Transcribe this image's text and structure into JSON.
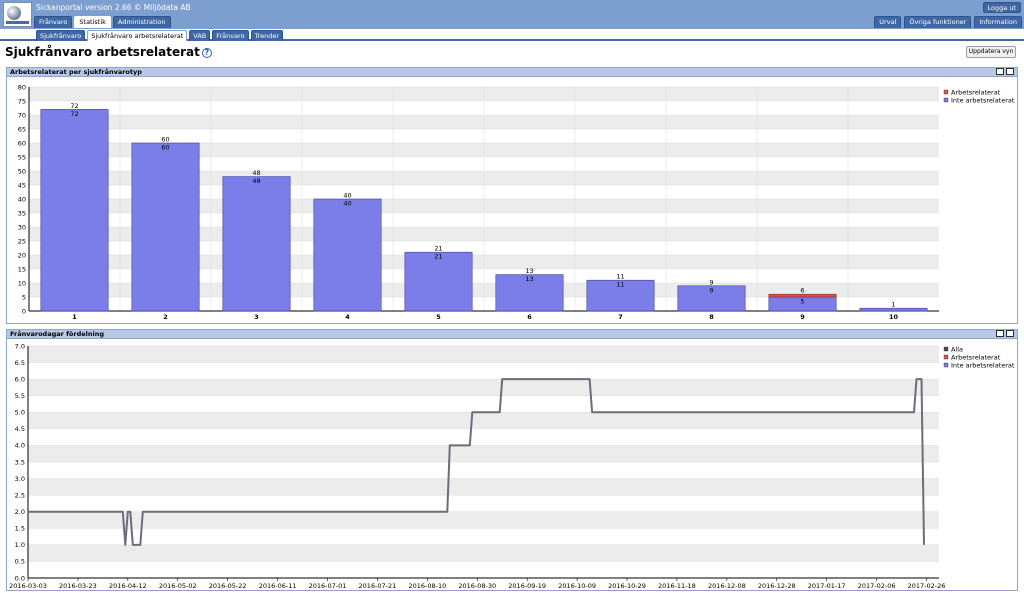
{
  "app": {
    "title": "Sickanportal version 2.66   © Miljödata AB",
    "logout_label": "Logga ut"
  },
  "main_nav": [
    {
      "label": "Frånvaro",
      "active": false
    },
    {
      "label": "Statistik",
      "active": true
    },
    {
      "label": "Administration",
      "active": false
    }
  ],
  "right_nav": [
    {
      "label": "Urval"
    },
    {
      "label": "Övriga funktioner"
    },
    {
      "label": "Information"
    }
  ],
  "sub_nav": [
    {
      "label": "Sjukfrånvaro",
      "active": false
    },
    {
      "label": "Sjukfrånvaro arbetsrelaterat",
      "active": true
    },
    {
      "label": "VAB",
      "active": false
    },
    {
      "label": "Frånvaro",
      "active": false
    },
    {
      "label": "Trender",
      "active": false
    }
  ],
  "page": {
    "title": "Sjukfrånvaro arbetsrelaterat",
    "help_icon": "question-circle-icon",
    "update_label": "Uppdatera vyn"
  },
  "colors": {
    "header_blue": "#7d9fcf",
    "tab_blue": "#3f67a6",
    "bar_blue": "#7b7ee8",
    "work_red": "#d45353",
    "line_gray": "#6d6d7a"
  },
  "chart_data": [
    {
      "type": "bar",
      "title": "Arbetsrelaterat per sjukfrånvarotyp",
      "categories": [
        "1",
        "2",
        "3",
        "4",
        "5",
        "6",
        "7",
        "8",
        "9",
        "10"
      ],
      "series": [
        {
          "name": "Arbetsrelaterat",
          "color": "#d45353",
          "values": [
            0,
            0,
            0,
            0,
            0,
            0,
            0,
            0,
            1,
            0
          ]
        },
        {
          "name": "Inte arbetsrelaterat",
          "color": "#7b7ee8",
          "values": [
            72,
            60,
            48,
            40,
            21,
            13,
            11,
            9,
            5,
            1
          ]
        }
      ],
      "totals": [
        72,
        60,
        48,
        40,
        21,
        13,
        11,
        9,
        6,
        1
      ],
      "ylim": [
        0,
        80
      ],
      "yticks": [
        0,
        5,
        10,
        15,
        20,
        25,
        30,
        35,
        40,
        45,
        50,
        55,
        60,
        65,
        70,
        75,
        80
      ],
      "stacked": true,
      "grid": true,
      "legend": "top-right"
    },
    {
      "type": "line",
      "title": "Frånvarodagar fördelning",
      "ylim": [
        0,
        7
      ],
      "yticks": [
        "0.0",
        "0.5",
        "1.0",
        "1.5",
        "2.0",
        "2.5",
        "3.0",
        "3.5",
        "4.0",
        "4.5",
        "5.0",
        "5.5",
        "6.0",
        "6.5",
        "7.0"
      ],
      "xlim": [
        "2016-03-03",
        "2017-03-03"
      ],
      "xticks": [
        "2016-03-03",
        "2016-03-23",
        "2016-04-12",
        "2016-05-02",
        "2016-05-22",
        "2016-06-11",
        "2016-07-01",
        "2016-07-21",
        "2016-08-10",
        "2016-08-30",
        "2016-09-19",
        "2016-10-09",
        "2016-10-29",
        "2016-11-18",
        "2016-12-08",
        "2016-12-28",
        "2017-01-17",
        "2017-02-06",
        "2017-02-26"
      ],
      "legend_entries": [
        {
          "name": "Alla",
          "color": "#4a4a4a"
        },
        {
          "name": "Arbetsrelaterat",
          "color": "#d45353"
        },
        {
          "name": "Inte arbetsrelaterat",
          "color": "#7b7ee8"
        }
      ],
      "series": [
        {
          "name": "Alla",
          "color": "#6d6d7a",
          "points": [
            [
              "2016-03-03",
              2
            ],
            [
              "2016-04-10",
              2
            ],
            [
              "2016-04-11",
              1
            ],
            [
              "2016-04-12",
              2
            ],
            [
              "2016-04-13",
              2
            ],
            [
              "2016-04-14",
              1
            ],
            [
              "2016-04-17",
              1
            ],
            [
              "2016-04-18",
              2
            ],
            [
              "2016-08-18",
              2
            ],
            [
              "2016-08-19",
              4
            ],
            [
              "2016-08-27",
              4
            ],
            [
              "2016-08-28",
              5
            ],
            [
              "2016-09-08",
              5
            ],
            [
              "2016-09-09",
              6
            ],
            [
              "2016-10-14",
              6
            ],
            [
              "2016-10-15",
              5
            ],
            [
              "2017-02-21",
              5
            ],
            [
              "2017-02-22",
              6
            ],
            [
              "2017-02-24",
              6
            ],
            [
              "2017-02-25",
              1
            ]
          ]
        }
      ],
      "grid": true,
      "legend": "top-right"
    }
  ]
}
